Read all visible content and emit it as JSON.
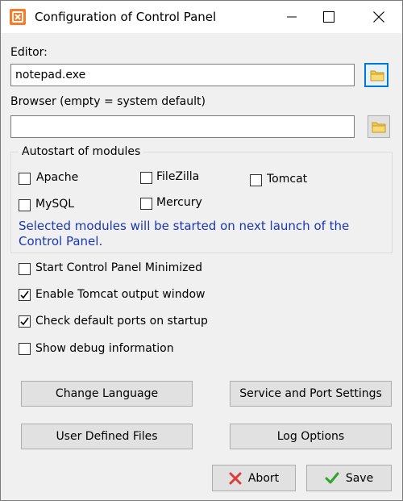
{
  "window": {
    "title": "Configuration of Control Panel"
  },
  "editor": {
    "label": "Editor:",
    "value": "notepad.exe"
  },
  "browser": {
    "label": "Browser (empty = system default)",
    "value": ""
  },
  "autostart": {
    "title": "Autostart of modules",
    "modules": [
      {
        "label": "Apache",
        "checked": false
      },
      {
        "label": "FileZilla",
        "checked": false
      },
      {
        "label": "Tomcat",
        "checked": false
      },
      {
        "label": "MySQL",
        "checked": false
      },
      {
        "label": "Mercury",
        "checked": false
      }
    ],
    "note": "Selected modules will be started on next launch of the Control Panel.",
    "note_color": "#1a37b5"
  },
  "options": [
    {
      "label": "Start Control Panel Minimized",
      "checked": false
    },
    {
      "label": "Enable Tomcat output window",
      "checked": true
    },
    {
      "label": "Check default ports on startup",
      "checked": true
    },
    {
      "label": "Show debug information",
      "checked": false
    }
  ],
  "buttons": {
    "change_language": "Change Language",
    "service_port": "Service and Port Settings",
    "user_files": "User Defined Files",
    "log_options": "Log Options",
    "abort": "Abort",
    "save": "Save"
  },
  "icons": {
    "app": "xampp-icon",
    "folder": "folder-icon",
    "abort": "red-x-icon",
    "save": "green-check-icon"
  },
  "colors": {
    "accent": "#0078d7",
    "app_icon": "#fb7a24",
    "abort": "#e03a3a",
    "save": "#2aa52a"
  }
}
